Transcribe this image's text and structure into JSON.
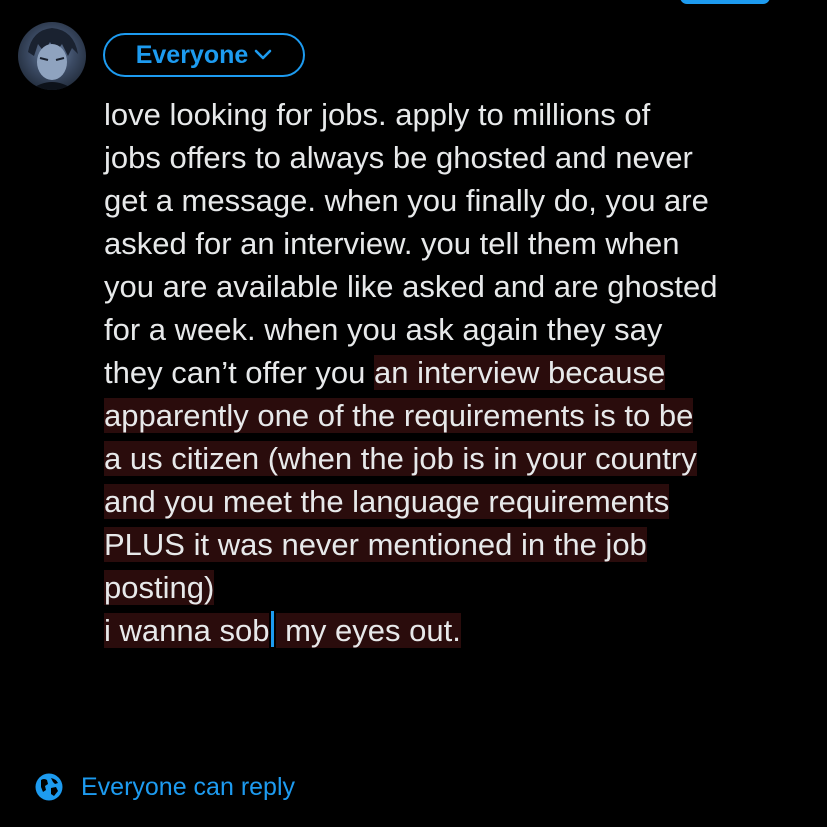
{
  "composer": {
    "audience_label": "Everyone",
    "lines": [
      "love looking for jobs. apply to millions of",
      "jobs offers to always be ghosted and never",
      "get a message. when you finally do, you are",
      "asked for an interview. you tell them when",
      "you are available like asked and are ghosted",
      "for a week. when you ask again they say"
    ],
    "line7_plain": "they can’t offer you ",
    "line7_selected": "an interview because",
    "selected_lines": [
      "apparently one of the requirements is to be",
      "a us citizen (when the job is in your country",
      "and you meet the language requirements",
      "PLUS it was never mentioned in the job",
      "posting)"
    ],
    "last_line_before_caret": "i wanna sob",
    "last_line_after_caret": " my eyes out."
  },
  "reply_setting": {
    "label": "Everyone can reply",
    "icon": "globe-icon"
  },
  "colors": {
    "accent": "#1d9bf0",
    "background": "#000000",
    "text": "#e7e9ea",
    "selection": "#2a0c0c"
  }
}
